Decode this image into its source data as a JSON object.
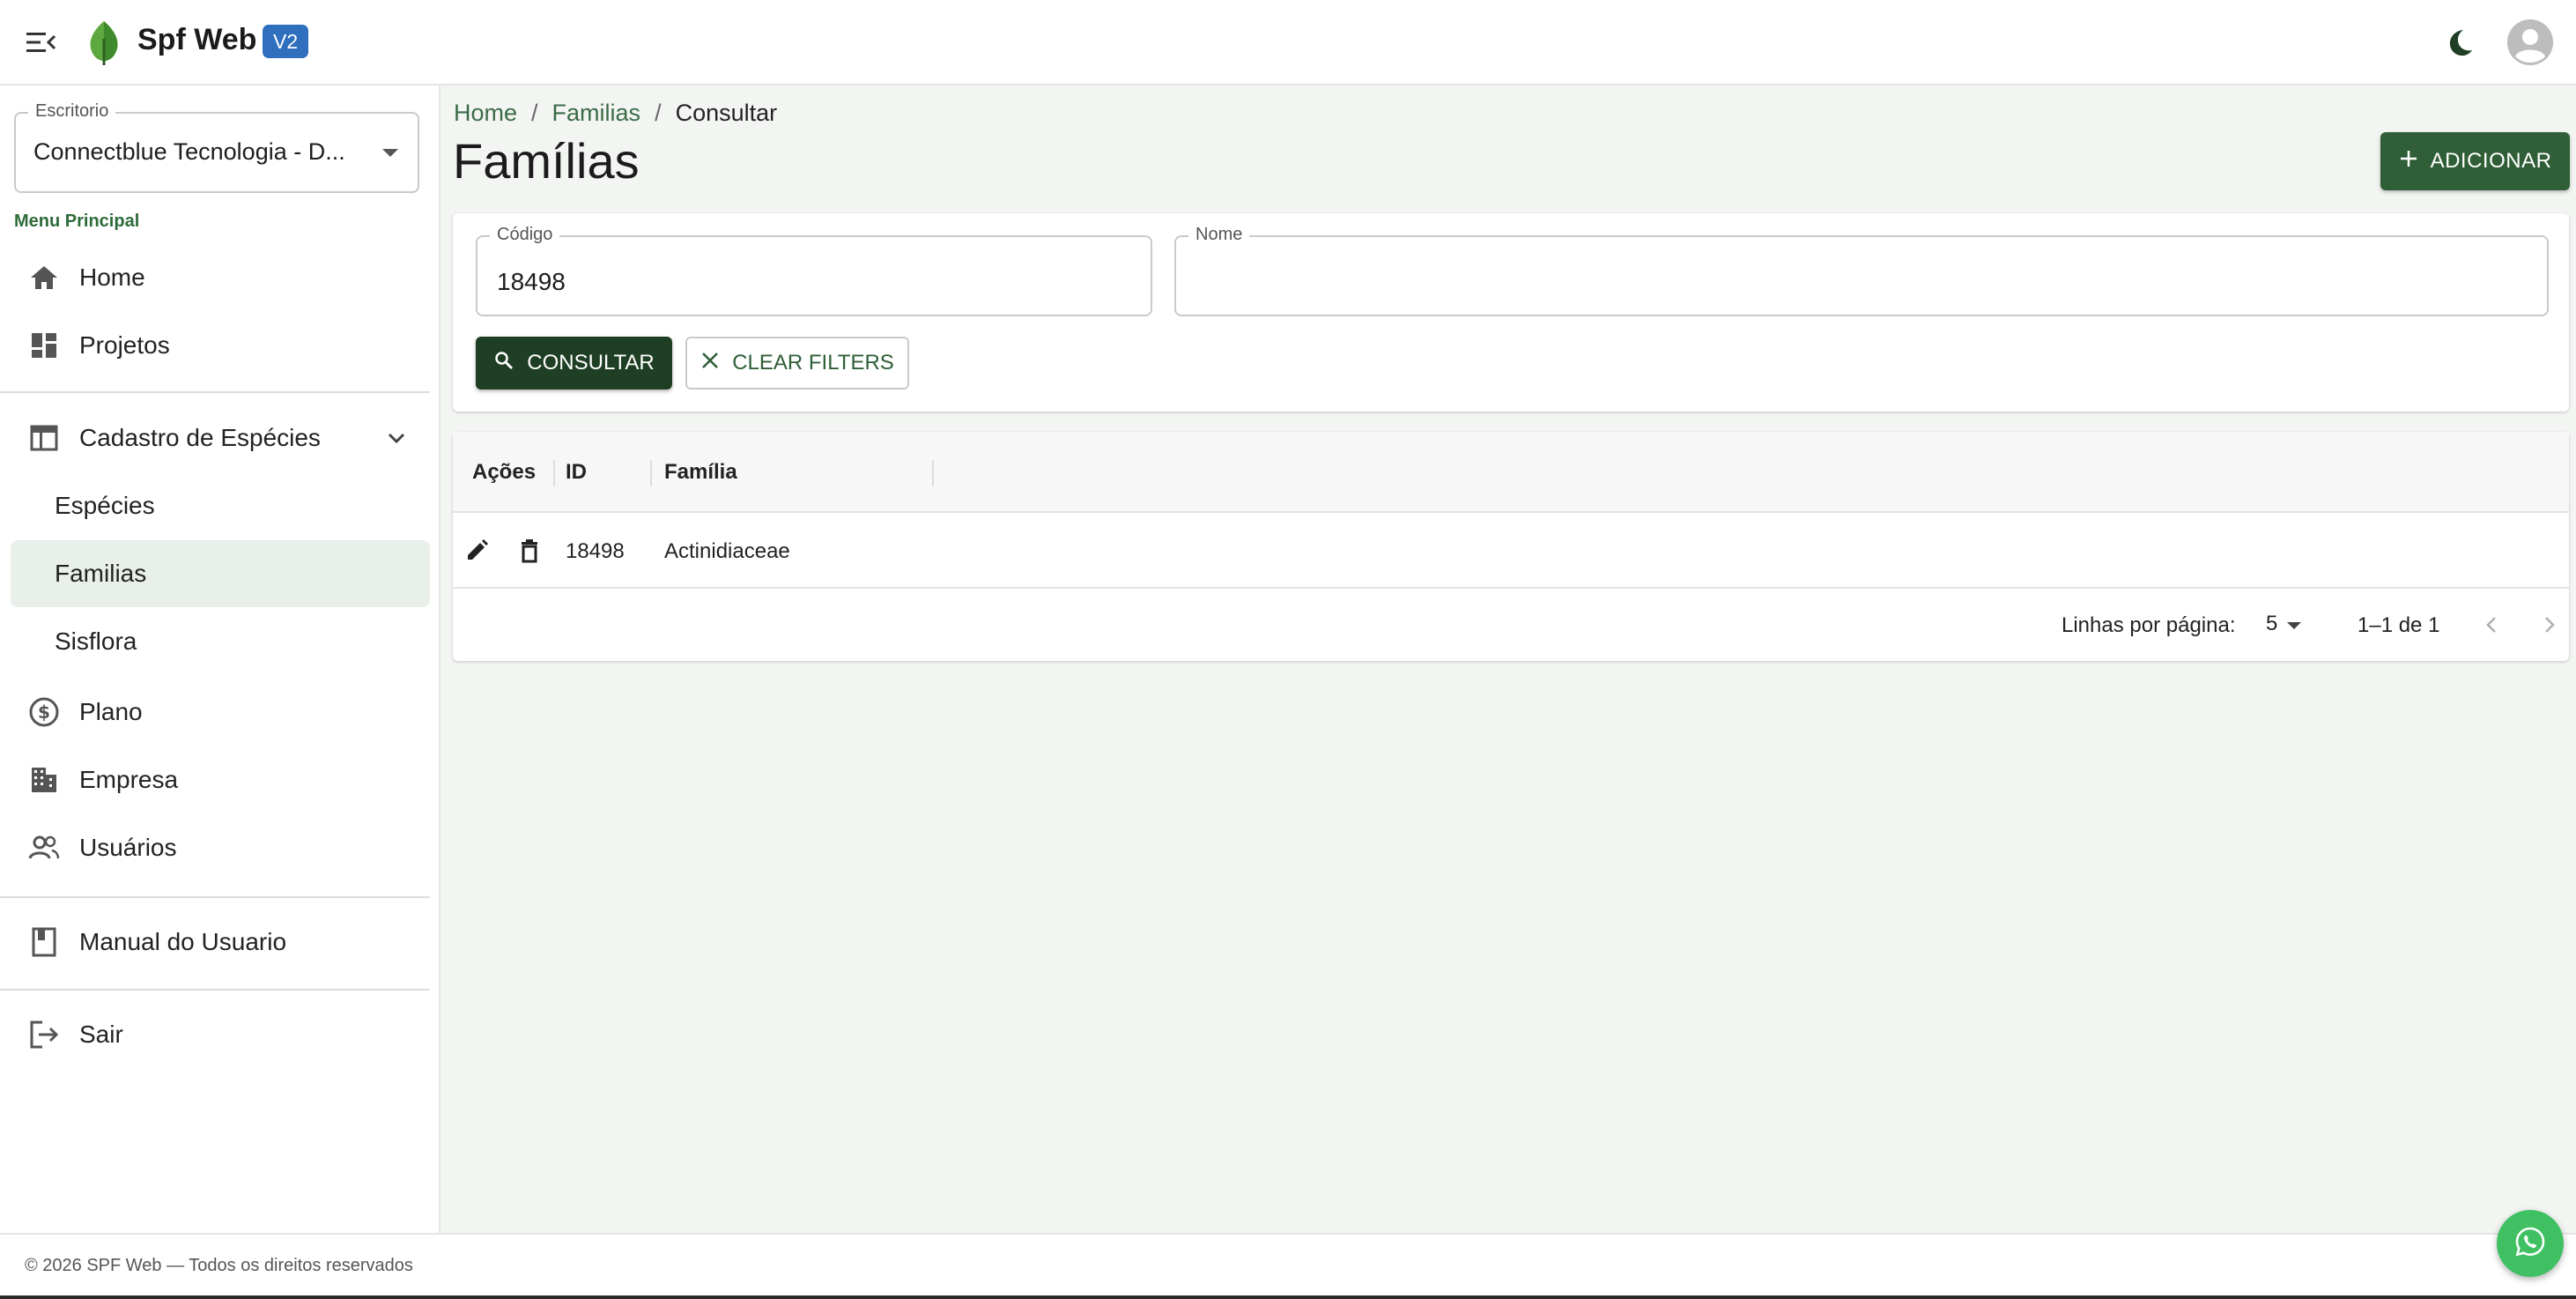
{
  "app": {
    "title": "Spf Web",
    "version_badge": "V2",
    "brand_color": "#2f5e37",
    "badge_color": "#2f6fbd"
  },
  "sidebar": {
    "office_select": {
      "label": "Escritorio",
      "value": "Connectblue Tecnologia - D..."
    },
    "section_title": "Menu Principal",
    "items": [
      {
        "label": "Home",
        "icon": "home-icon"
      },
      {
        "label": "Projetos",
        "icon": "dashboard-icon"
      },
      {
        "label": "Cadastro de Espécies",
        "icon": "table-icon",
        "expanded": true
      },
      {
        "label": "Espécies",
        "sub": true
      },
      {
        "label": "Familias",
        "sub": true,
        "active": true
      },
      {
        "label": "Sisflora",
        "sub": true
      },
      {
        "label": "Plano",
        "icon": "dollar-circle-icon"
      },
      {
        "label": "Empresa",
        "icon": "building-icon"
      },
      {
        "label": "Usuários",
        "icon": "people-icon"
      },
      {
        "label": "Manual do Usuario",
        "icon": "book-icon"
      },
      {
        "label": "Sair",
        "icon": "logout-icon"
      }
    ]
  },
  "breadcrumb": {
    "items": [
      "Home",
      "Familias",
      "Consultar"
    ],
    "separator": "/"
  },
  "page": {
    "title": "Famílias",
    "add_label": "ADICIONAR"
  },
  "filters": {
    "codigo": {
      "label": "Código",
      "value": "18498"
    },
    "nome": {
      "label": "Nome",
      "value": ""
    },
    "consult_label": "CONSULTAR",
    "clear_label": "CLEAR FILTERS"
  },
  "table": {
    "columns": [
      "Ações",
      "ID",
      "Família"
    ],
    "rows": [
      {
        "id": "18498",
        "familia": "Actinidiaceae"
      }
    ],
    "pagination": {
      "rows_per_page_label": "Linhas por página:",
      "rows_per_page": "5",
      "range": "1–1 de 1"
    }
  },
  "footer": {
    "copyright": "© 2026 SPF Web — Todos os direitos reservados"
  }
}
